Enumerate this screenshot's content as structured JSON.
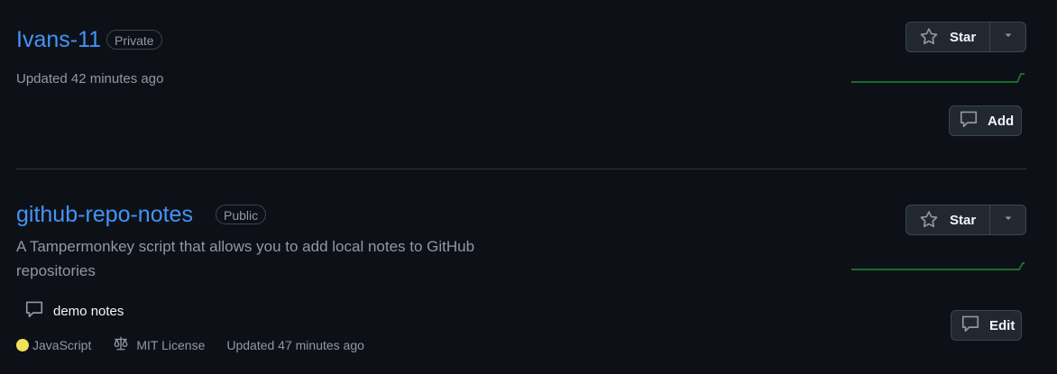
{
  "colors": {
    "background": "#0d1117",
    "link": "#4493f8",
    "muted": "#9198a1",
    "button_bg": "#212830",
    "border": "#3d444d",
    "spark": "#2ea043",
    "javascript": "#f1e05a"
  },
  "repos": [
    {
      "name": "Ivans-11",
      "visibility": "Private",
      "updated": "Updated 42 minutes ago",
      "star_label": "Star",
      "note_button_label": "Add",
      "icons": {
        "star": "star-icon",
        "dropdown": "triangle-down-icon",
        "note": "comment-icon"
      }
    },
    {
      "name": "github-repo-notes",
      "visibility": "Public",
      "description": "A Tampermonkey script that allows you to add local notes to GitHub repositories",
      "note_text": "demo notes",
      "language": "JavaScript",
      "license": "MIT License",
      "updated": "Updated 47 minutes ago",
      "star_label": "Star",
      "note_button_label": "Edit",
      "icons": {
        "star": "star-icon",
        "dropdown": "triangle-down-icon",
        "note": "comment-icon",
        "license": "law-icon"
      }
    }
  ]
}
